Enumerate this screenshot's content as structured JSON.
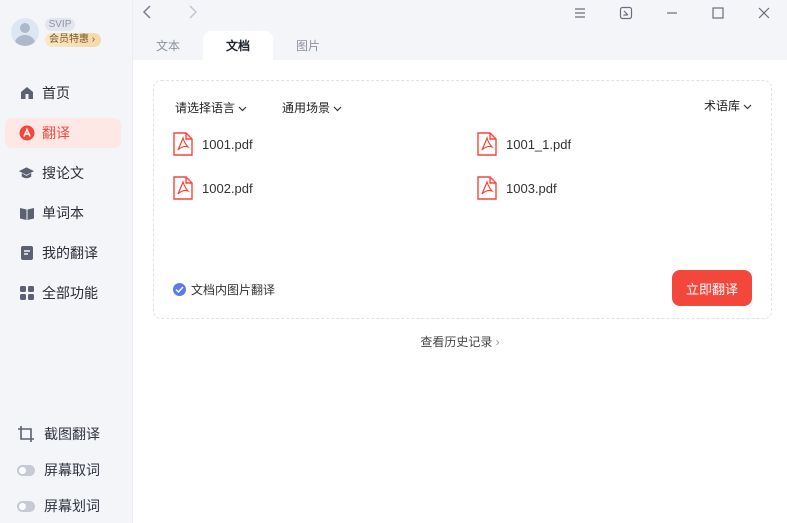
{
  "user": {
    "badge": "SVIP",
    "perk_label": "会员特惠"
  },
  "sidebar": {
    "items": [
      {
        "label": "首页",
        "icon": "home-icon",
        "active": false
      },
      {
        "label": "翻译",
        "icon": "translate-icon",
        "active": true
      },
      {
        "label": "搜论文",
        "icon": "graduation-cap-icon",
        "active": false
      },
      {
        "label": "单词本",
        "icon": "book-icon",
        "active": false
      },
      {
        "label": "我的翻译",
        "icon": "document-icon",
        "active": false
      },
      {
        "label": "全部功能",
        "icon": "grid-icon",
        "active": false
      }
    ],
    "tools": [
      {
        "label": "截图翻译",
        "icon": "crop-icon"
      },
      {
        "label": "屏幕取词",
        "icon": "toggle-icon"
      },
      {
        "label": "屏幕划词",
        "icon": "toggle-icon"
      }
    ]
  },
  "tabs": [
    {
      "label": "文本",
      "active": false
    },
    {
      "label": "文档",
      "active": true
    },
    {
      "label": "图片",
      "active": false
    }
  ],
  "panel": {
    "language_select": "请选择语言",
    "scene_select": "通用场景",
    "glossary_select": "术语库",
    "files": [
      "1001.pdf",
      "1001_1.pdf",
      "1002.pdf",
      "1003.pdf"
    ],
    "image_option": "文档内图片翻译",
    "translate_button": "立即翻译"
  },
  "history_link": "查看历史记录",
  "colors": {
    "accent": "#f4473c",
    "active_bg": "#fde8e6",
    "check": "#5b7bef",
    "sidebar_bg": "#f4f5f9"
  }
}
